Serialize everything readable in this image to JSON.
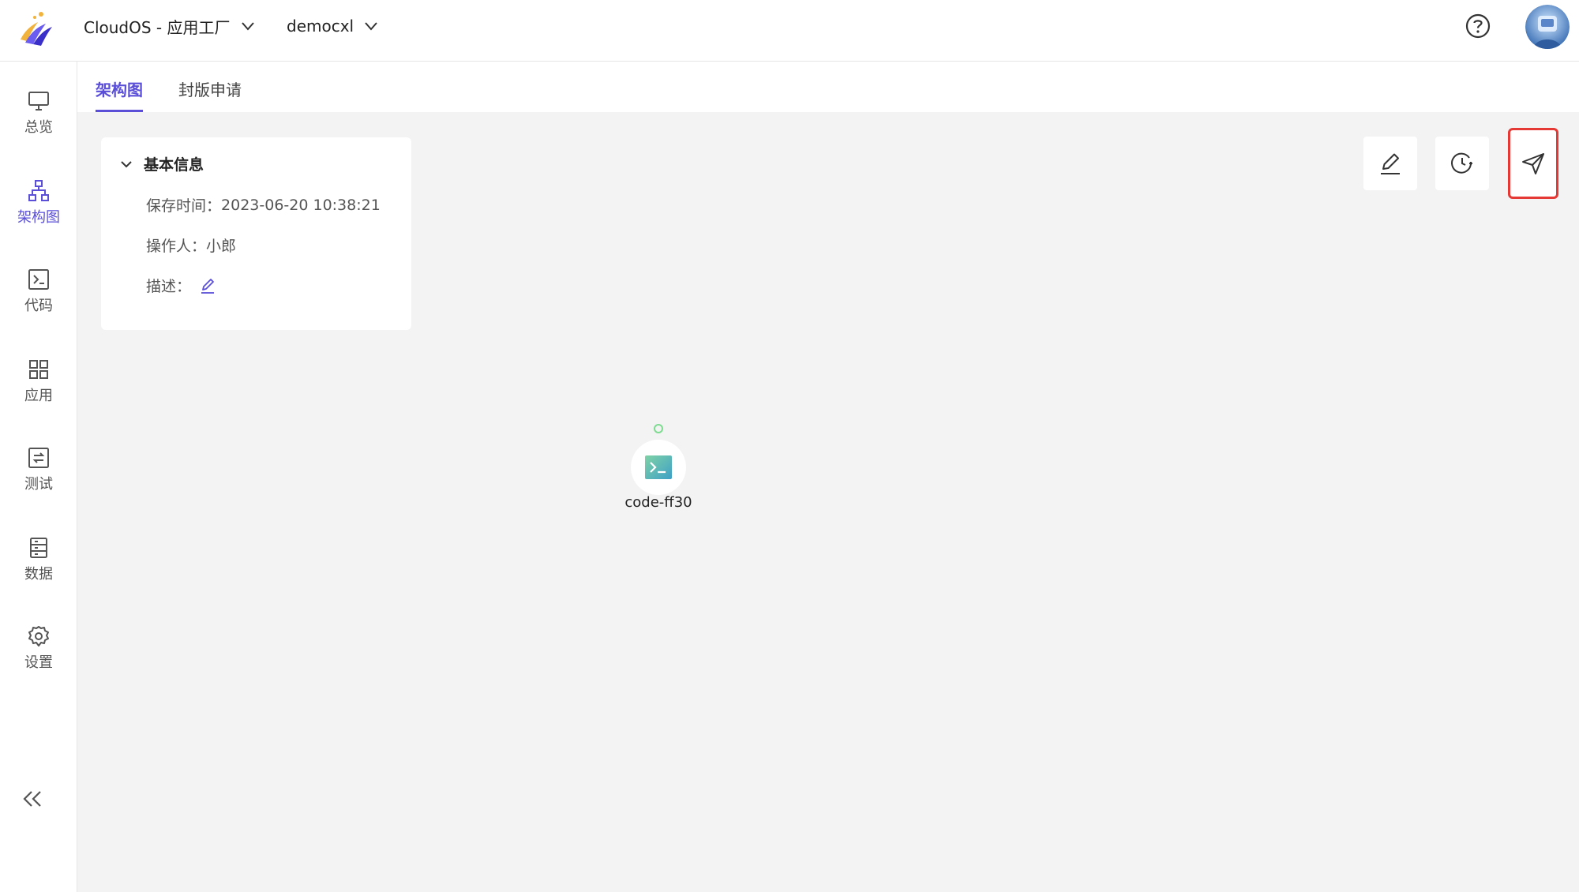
{
  "header": {
    "app_selector": "CloudOS - 应用工厂",
    "user_selector": "democxl"
  },
  "sidebar": {
    "items": [
      {
        "label": "总览",
        "icon": "monitor-icon"
      },
      {
        "label": "架构图",
        "icon": "architecture-icon"
      },
      {
        "label": "代码",
        "icon": "terminal-icon"
      },
      {
        "label": "应用",
        "icon": "grid-icon"
      },
      {
        "label": "测试",
        "icon": "test-icon"
      },
      {
        "label": "数据",
        "icon": "database-icon"
      },
      {
        "label": "设置",
        "icon": "gear-icon"
      }
    ],
    "active_index": 1
  },
  "tabs": [
    {
      "label": "架构图",
      "active": true
    },
    {
      "label": "封版申请",
      "active": false
    }
  ],
  "info_card": {
    "title": "基本信息",
    "save_time_label": "保存时间：",
    "save_time_value": "2023-06-20 10:38:21",
    "operator_label": "操作人：",
    "operator_value": "小郎",
    "desc_label": "描述："
  },
  "node": {
    "label": "code-ff30",
    "icon": "code-terminal-icon"
  },
  "colors": {
    "accent": "#5b4fd8",
    "highlight_border": "#e53935",
    "port": "#7ddc8f",
    "canvas_bg": "#f3f3f4"
  }
}
